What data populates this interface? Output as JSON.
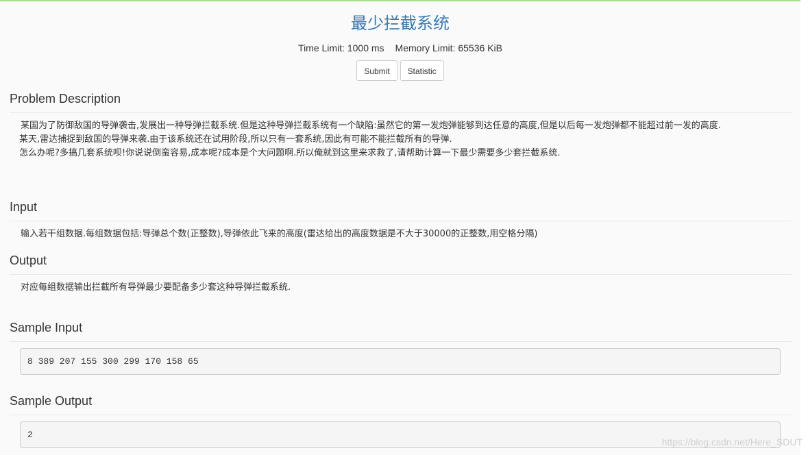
{
  "problem": {
    "title": "最少拦截系统",
    "time_limit": "Time Limit: 1000 ms",
    "memory_limit": "Memory Limit: 65536 KiB"
  },
  "buttons": {
    "submit": "Submit",
    "statistic": "Statistic"
  },
  "description": {
    "heading": "Problem Description",
    "lines": [
      " 某国为了防御敌国的导弹袭击,发展出一种导弹拦截系统.但是这种导弹拦截系统有一个缺陷:虽然它的第一发炮弹能够到达任意的高度,但是以后每一发炮弹都不能超过前一发的高度.",
      "某天,雷达捕捉到敌国的导弹来袭.由于该系统还在试用阶段,所以只有一套系统,因此有可能不能拦截所有的导弹.",
      "怎么办呢?多搞几套系统呗!你说说倒蛮容易,成本呢?成本是个大问题啊.所以俺就到这里来求救了,请帮助计算一下最少需要多少套拦截系统."
    ]
  },
  "input": {
    "heading": "Input",
    "text": " 输入若干组数据.每组数据包括:导弹总个数(正整数),导弹依此飞来的高度(雷达给出的高度数据是不大于30000的正整数,用空格分隔)"
  },
  "output": {
    "heading": "Output",
    "text": " 对应每组数据输出拦截所有导弹最少要配备多少套这种导弹拦截系统."
  },
  "sample_input": {
    "heading": "Sample Input",
    "text": "8 389 207 155 300 299 170 158 65"
  },
  "sample_output": {
    "heading": "Sample Output",
    "text": "2"
  },
  "watermark": "https://blog.csdn.net/Here_SDUT",
  "colors": {
    "title": "#337ab7",
    "top_border": "#a4e08a",
    "page_bg": "#fafafa"
  }
}
